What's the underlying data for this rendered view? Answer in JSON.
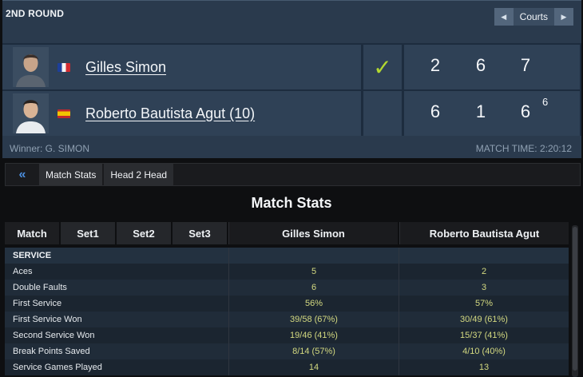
{
  "round": "2ND ROUND",
  "courts": {
    "label": "Courts",
    "prev_icon": "chevron-left-icon",
    "next_icon": "chevron-right-icon"
  },
  "players": [
    {
      "name": "Gilles Simon",
      "flag": "france",
      "winner": true,
      "sets": [
        "2",
        "6",
        "7"
      ],
      "tiebreak": ""
    },
    {
      "name": "Roberto Bautista Agut (10)",
      "flag": "spain",
      "winner": false,
      "sets": [
        "6",
        "1",
        "6"
      ],
      "tiebreak": "6"
    }
  ],
  "winner_icon": "✓",
  "winner_text": "Winner: G. SIMON",
  "match_time": "MATCH TIME: 2:20:12",
  "tabs": {
    "back": "«",
    "match_stats": "Match Stats",
    "head2head": "Head 2 Head"
  },
  "section_title": "Match Stats",
  "table": {
    "periods": [
      "Match",
      "Set1",
      "Set2",
      "Set3"
    ],
    "col_player1": "Gilles Simon",
    "col_player2": "Roberto Bautista Agut",
    "rows": [
      {
        "type": "section",
        "label": "SERVICE",
        "v1": "",
        "v2": ""
      },
      {
        "label": "Aces",
        "v1": "5",
        "v2": "2"
      },
      {
        "label": "Double Faults",
        "v1": "6",
        "v2": "3"
      },
      {
        "label": "First Service",
        "v1": "56%",
        "v2": "57%"
      },
      {
        "label": "First Service Won",
        "v1": "39/58 (67%)",
        "v2": "30/49 (61%)"
      },
      {
        "label": "Second Service Won",
        "v1": "19/46 (41%)",
        "v2": "15/37 (41%)"
      },
      {
        "label": "Break Points Saved",
        "v1": "8/14 (57%)",
        "v2": "4/10 (40%)"
      },
      {
        "label": "Service Games Played",
        "v1": "14",
        "v2": "13"
      }
    ]
  },
  "colors": {
    "check": "#b3d830",
    "stat_value": "#d3d980",
    "back_arrow": "#4b8fe0"
  }
}
